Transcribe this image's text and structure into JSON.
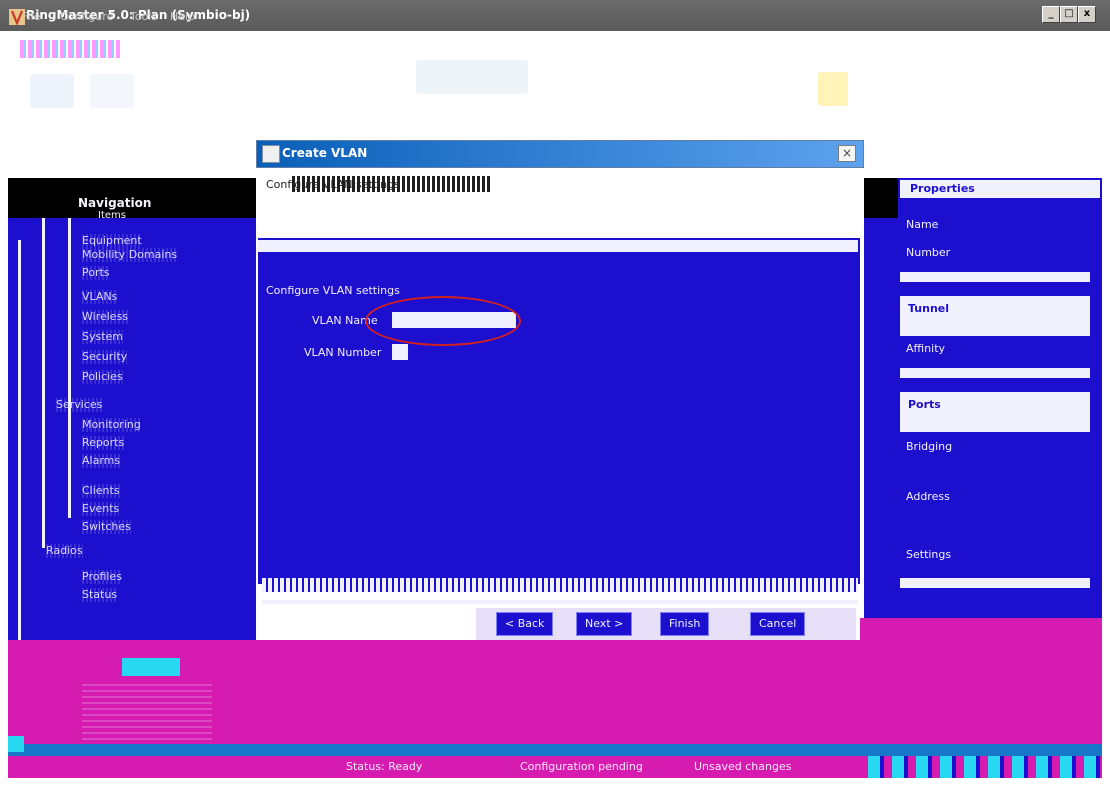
{
  "window": {
    "title": "RingMaster 5.0: Plan (Symbio-bj)",
    "minimize": "_",
    "maximize": "□",
    "close": "x"
  },
  "menu": [
    "File",
    "Configure",
    "Tools",
    "Help"
  ],
  "navtree": {
    "title": "Navigation",
    "subtitle": "Items",
    "items": [
      "Equipment",
      "Mobility Domains",
      "Ports",
      "VLANs",
      "Wireless",
      "System",
      "Security",
      "Policies",
      "Services",
      "Monitoring",
      "Reports",
      "Alarms",
      "Clients",
      "Events",
      "Switches",
      "Radios",
      "Profiles",
      "Status"
    ]
  },
  "dialog": {
    "title": "Create VLAN",
    "close": "×",
    "heading": "Configure VLAN settings",
    "name_label": "VLAN Name",
    "number_label": "VLAN Number",
    "buttons": [
      "< Back",
      "Next >",
      "Finish",
      "Cancel"
    ]
  },
  "right_panel": {
    "header": "Properties",
    "items": [
      "Name",
      "Number",
      "Tunnel",
      "Affinity",
      "Ports",
      "Bridging",
      "Address",
      "Settings"
    ]
  },
  "status": [
    "Status: Ready",
    "Configuration pending",
    "Unsaved changes"
  ],
  "colors": {
    "navy": "#1d0fce",
    "magenta": "#d61bb0",
    "title_blue": "#0a5fb8",
    "annotation": "#d02020"
  }
}
